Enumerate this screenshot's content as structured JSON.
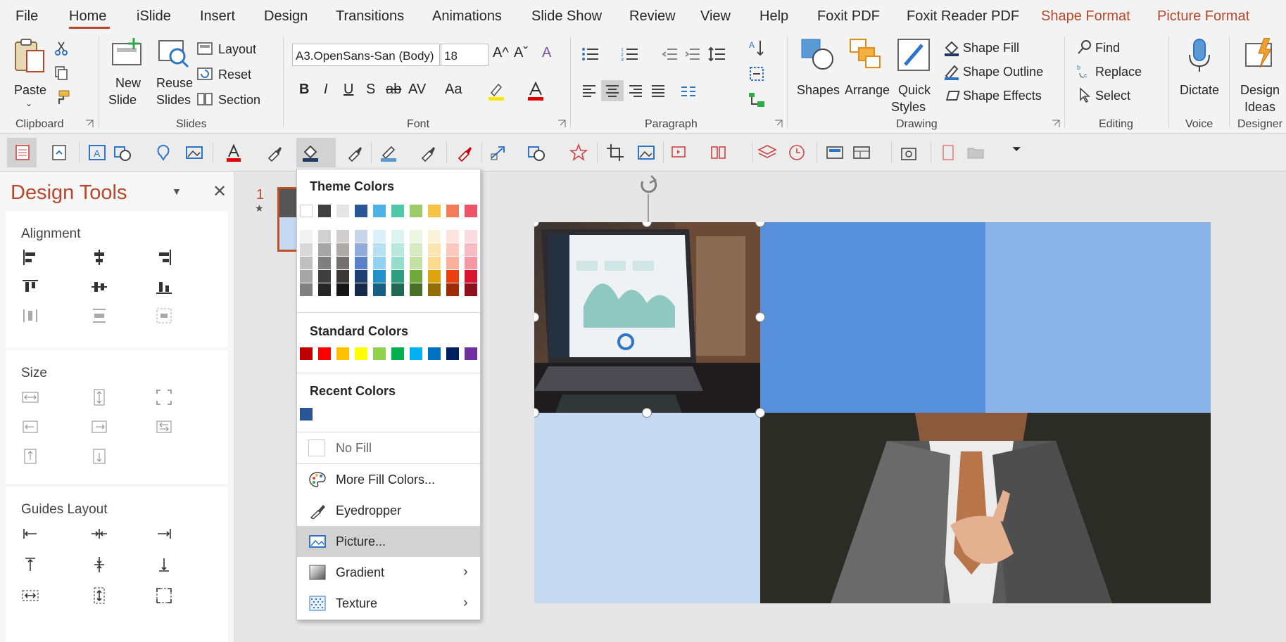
{
  "tabs": [
    "File",
    "Home",
    "iSlide",
    "Insert",
    "Design",
    "Transitions",
    "Animations",
    "Slide Show",
    "Review",
    "View",
    "Help",
    "Foxit PDF",
    "Foxit Reader PDF",
    "Shape Format",
    "Picture Format"
  ],
  "ribbon": {
    "clipboard": {
      "paste": "Paste",
      "group": "Clipboard"
    },
    "slides": {
      "new_slide_1": "New",
      "new_slide_2": "Slide",
      "reuse_1": "Reuse",
      "reuse_2": "Slides",
      "layout": "Layout",
      "reset": "Reset",
      "section": "Section",
      "group": "Slides"
    },
    "font": {
      "font_name": "A3.OpenSans-San (Body)",
      "font_size": "18",
      "bold": "B",
      "italic": "I",
      "underline": "U",
      "shadow": "S",
      "strike": "ab",
      "spacing": "AV",
      "case": "Aa",
      "group": "Font"
    },
    "paragraph": {
      "group": "Paragraph"
    },
    "drawing": {
      "shapes": "Shapes",
      "arrange": "Arrange",
      "quick_1": "Quick",
      "quick_2": "Styles",
      "shape_fill": "Shape Fill",
      "shape_outline": "Shape Outline",
      "shape_effects": "Shape Effects",
      "group": "Drawing"
    },
    "editing": {
      "find": "Find",
      "replace": "Replace",
      "select": "Select",
      "group": "Editing"
    },
    "voice": {
      "dictate": "Dictate",
      "group": "Voice"
    },
    "designer": {
      "ideas_1": "Design",
      "ideas_2": "Ideas",
      "group": "Designer"
    }
  },
  "panel": {
    "title": "Design Tools",
    "alignment": "Alignment",
    "size": "Size",
    "guides": "Guides Layout"
  },
  "slide_number": "1",
  "fill_menu": {
    "theme_colors_label": "Theme Colors",
    "theme_top": [
      "#ffffff",
      "#404040",
      "#e7e6e6",
      "#2a5597",
      "#4db3e6",
      "#4fc7a8",
      "#9ccc6a",
      "#f5c242",
      "#f47c5c",
      "#ec5567"
    ],
    "theme_shades": [
      [
        "#f2f2f2",
        "#d9d9d9",
        "#bfbfbf",
        "#a6a6a6",
        "#808080"
      ],
      [
        "#d0d0d0",
        "#a6a6a6",
        "#7f7f7f",
        "#3f3f3f",
        "#262626"
      ],
      [
        "#d0cece",
        "#aeaaaa",
        "#757070",
        "#3b3838",
        "#161616"
      ],
      [
        "#c7d4ec",
        "#91acdb",
        "#5a82c9",
        "#1f3f71",
        "#152a4b"
      ],
      [
        "#dbf0fa",
        "#b8e1f5",
        "#94d1f0",
        "#2391c8",
        "#175f84"
      ],
      [
        "#dcf4ed",
        "#b9e9dc",
        "#95decb",
        "#2f9e80",
        "#1f6a55"
      ],
      [
        "#ebf5e1",
        "#d7ebc3",
        "#c3e1a5",
        "#70a93c",
        "#4a7128"
      ],
      [
        "#fdf3d9",
        "#fbe6b3",
        "#f9da8e",
        "#dea20c",
        "#946c08"
      ],
      [
        "#fde4de",
        "#fbcabd",
        "#f9b09d",
        "#ec3f10",
        "#9e2a0a"
      ],
      [
        "#fbdde1",
        "#f7bbc2",
        "#f499a4",
        "#d8172f",
        "#900f1f"
      ]
    ],
    "standard_colors_label": "Standard Colors",
    "standard": [
      "#c00000",
      "#ff0000",
      "#ffc000",
      "#ffff00",
      "#92d050",
      "#00b050",
      "#00b0f0",
      "#0070c0",
      "#002060",
      "#7030a0"
    ],
    "recent_colors_label": "Recent Colors",
    "recent": [
      "#2a5597"
    ],
    "no_fill": "No Fill",
    "more_fill": "More Fill Colors...",
    "eyedropper": "Eyedropper",
    "picture": "Picture...",
    "gradient": "Gradient",
    "texture": "Texture"
  },
  "slide_colors": {
    "block1": "#5690dc",
    "block2": "#8ab4e8",
    "block3": "#c5d9f1"
  }
}
